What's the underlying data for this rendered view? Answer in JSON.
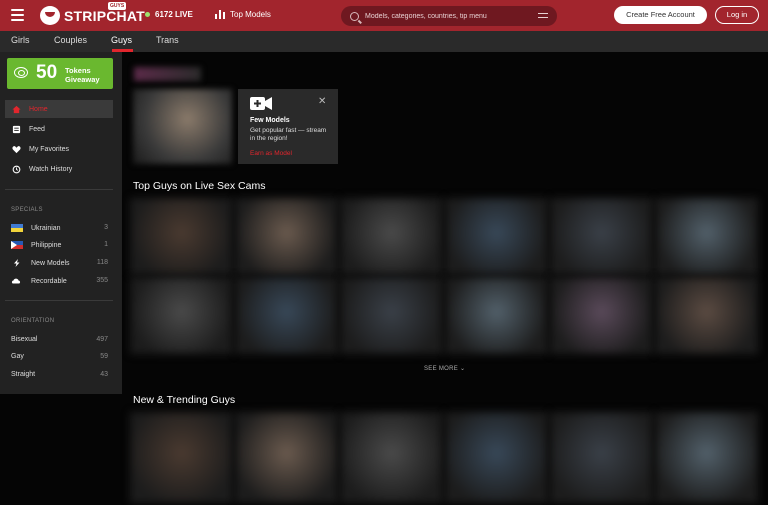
{
  "topbar": {
    "logo_text": "STRIPCHAT",
    "logo_badge": "GUYS",
    "live_count": "6172 LIVE",
    "top_models": "Top Models",
    "search_placeholder": "Models, categories, countries, tip menu",
    "create_account": "Create Free Account",
    "login": "Log in"
  },
  "subnav": {
    "tabs": [
      {
        "label": "Girls",
        "active": false
      },
      {
        "label": "Couples",
        "active": false
      },
      {
        "label": "Guys",
        "active": true
      },
      {
        "label": "Trans",
        "active": false
      }
    ]
  },
  "sidebar": {
    "giveaway": {
      "number": "50",
      "line1": "Tokens",
      "line2": "Giveaway"
    },
    "nav": [
      {
        "label": "Home",
        "icon": "home-icon",
        "active": true
      },
      {
        "label": "Feed",
        "icon": "feed-icon"
      },
      {
        "label": "My Favorites",
        "icon": "heart-icon"
      },
      {
        "label": "Watch History",
        "icon": "history-icon"
      }
    ],
    "specials_label": "SPECIALS",
    "specials": [
      {
        "label": "Ukrainian",
        "count": "3",
        "icon": "ukraine-flag-icon"
      },
      {
        "label": "Philippine",
        "count": "1",
        "icon": "philippines-flag-icon"
      },
      {
        "label": "New Models",
        "count": "118",
        "icon": "lightning-icon"
      },
      {
        "label": "Recordable",
        "count": "355",
        "icon": "recordable-icon"
      }
    ],
    "orientation_label": "ORIENTATION",
    "orientation": [
      {
        "label": "Bisexual",
        "count": "497"
      },
      {
        "label": "Gay",
        "count": "59"
      },
      {
        "label": "Straight",
        "count": "43"
      }
    ]
  },
  "promo_card": {
    "title": "Few Models",
    "text": "Get popular fast — stream in the region!",
    "link": "Earn as Model"
  },
  "sections": {
    "top_title": "Top Guys on Live Sex Cams",
    "see_more": "SEE MORE",
    "trending_title": "New & Trending Guys"
  },
  "colors": {
    "brand": "#a2252d",
    "accent_red": "#e1262d",
    "giveaway_green": "#6ab82f"
  }
}
